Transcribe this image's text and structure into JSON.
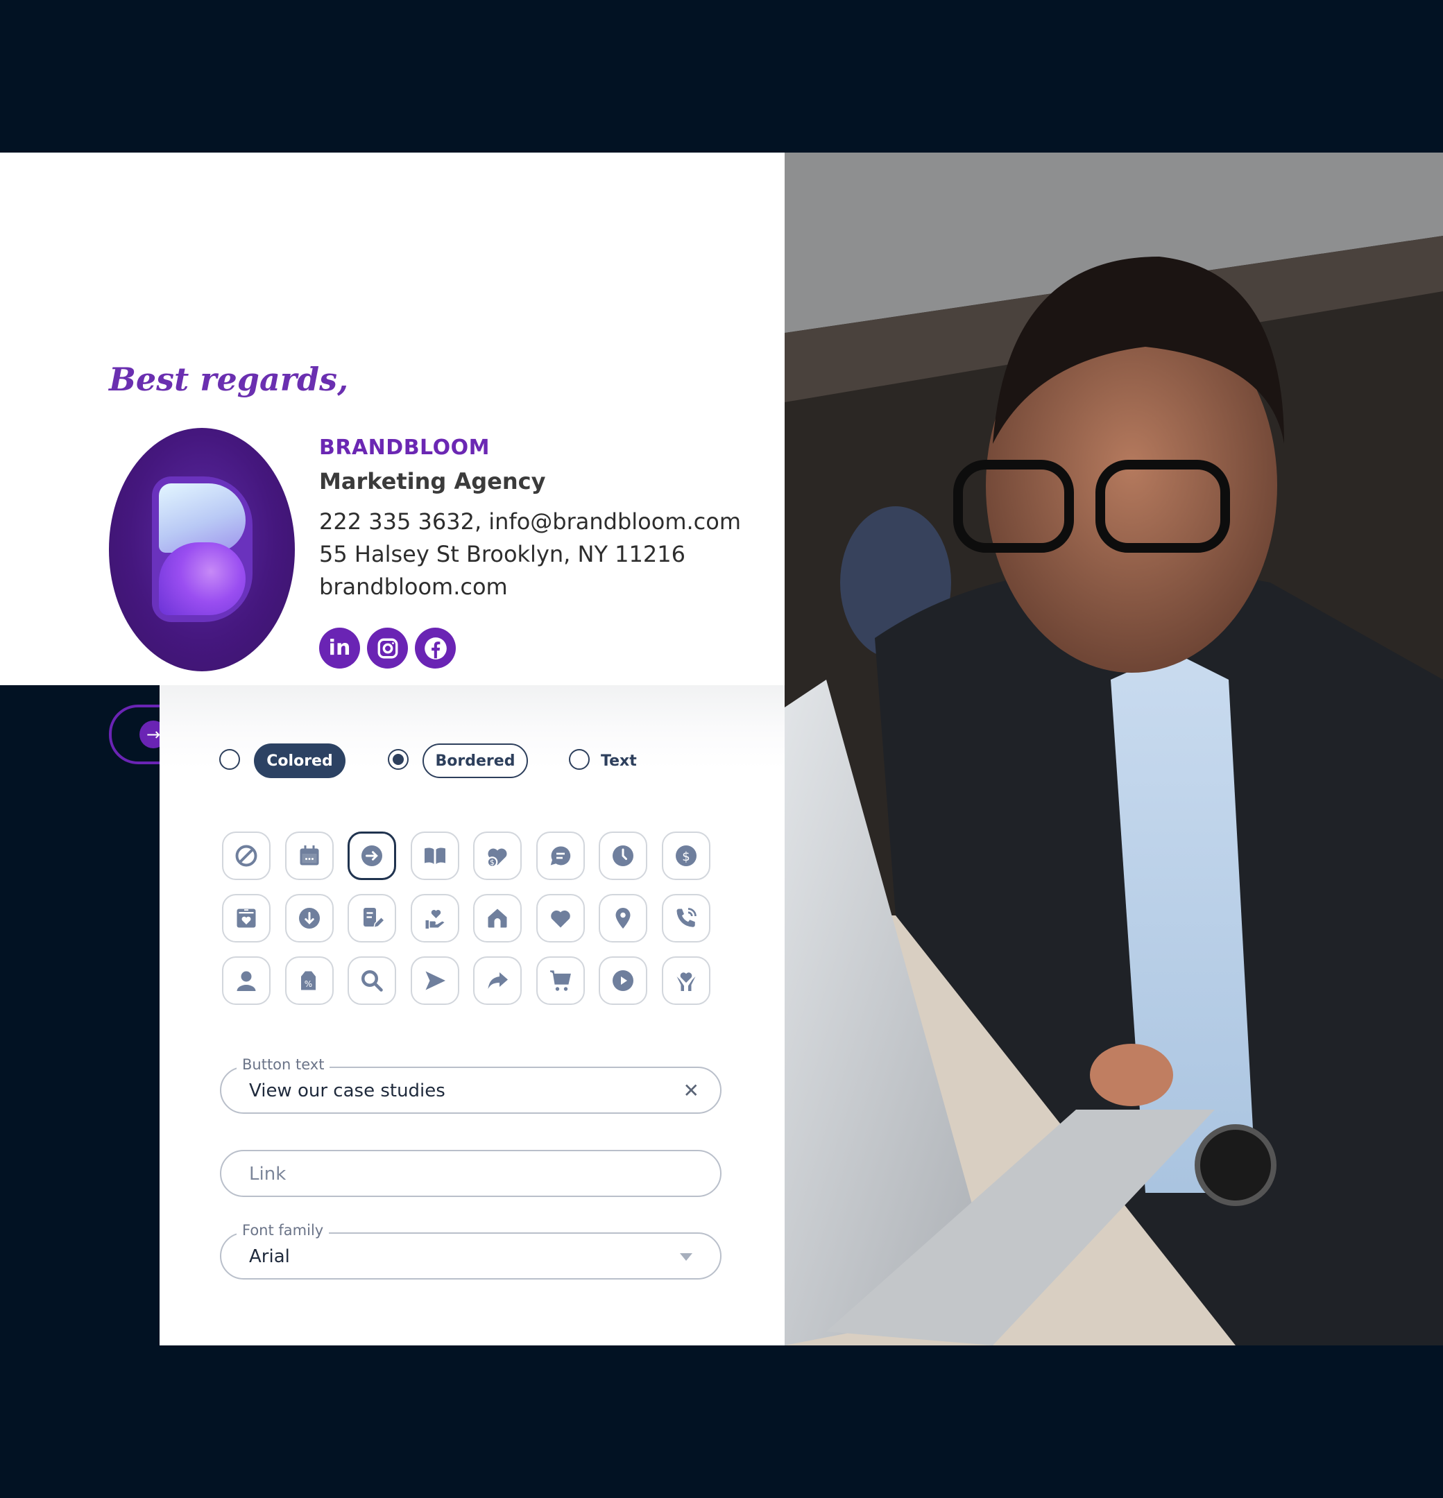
{
  "signature": {
    "greeting": "Best regards,",
    "company": "BRANDBLOOM",
    "tagline": "Marketing Agency",
    "contact_line": "222 335 3632, info@brandbloom.com",
    "address": "55 Halsey St Brooklyn, NY 11216",
    "website": "brandbloom.com",
    "socials": [
      {
        "name": "linkedin",
        "glyph": "in"
      },
      {
        "name": "instagram",
        "glyph": "◎"
      },
      {
        "name": "facebook",
        "glyph": "f"
      }
    ],
    "cta": {
      "icon": "arrow-right-circle",
      "glyph": "→",
      "label": "View our case studies"
    },
    "brand_color": "#6a24b4"
  },
  "editor": {
    "style_options": [
      {
        "label": "Colored",
        "selected": false
      },
      {
        "label": "Bordered",
        "selected": true
      },
      {
        "label": "Text",
        "selected": false
      }
    ],
    "icons": [
      "none",
      "calendar",
      "arrow-right-circle",
      "book-open",
      "heart-dollar",
      "chat-bubble",
      "clock",
      "dollar-circle",
      "gift-box-heart",
      "arrow-down-circle",
      "document-edit",
      "hand-heart",
      "home",
      "heart",
      "map-pin",
      "phone-call",
      "user",
      "price-tag-percent",
      "search",
      "send",
      "share-arrow",
      "shopping-cart",
      "play-circle",
      "hands-heart"
    ],
    "selected_icon": "arrow-right-circle",
    "button_text": {
      "label": "Button text",
      "value": "View our case studies"
    },
    "link": {
      "placeholder": "Link",
      "value": ""
    },
    "font_family": {
      "label": "Font family",
      "value": "Arial"
    },
    "accent_color": "#2c4263"
  }
}
